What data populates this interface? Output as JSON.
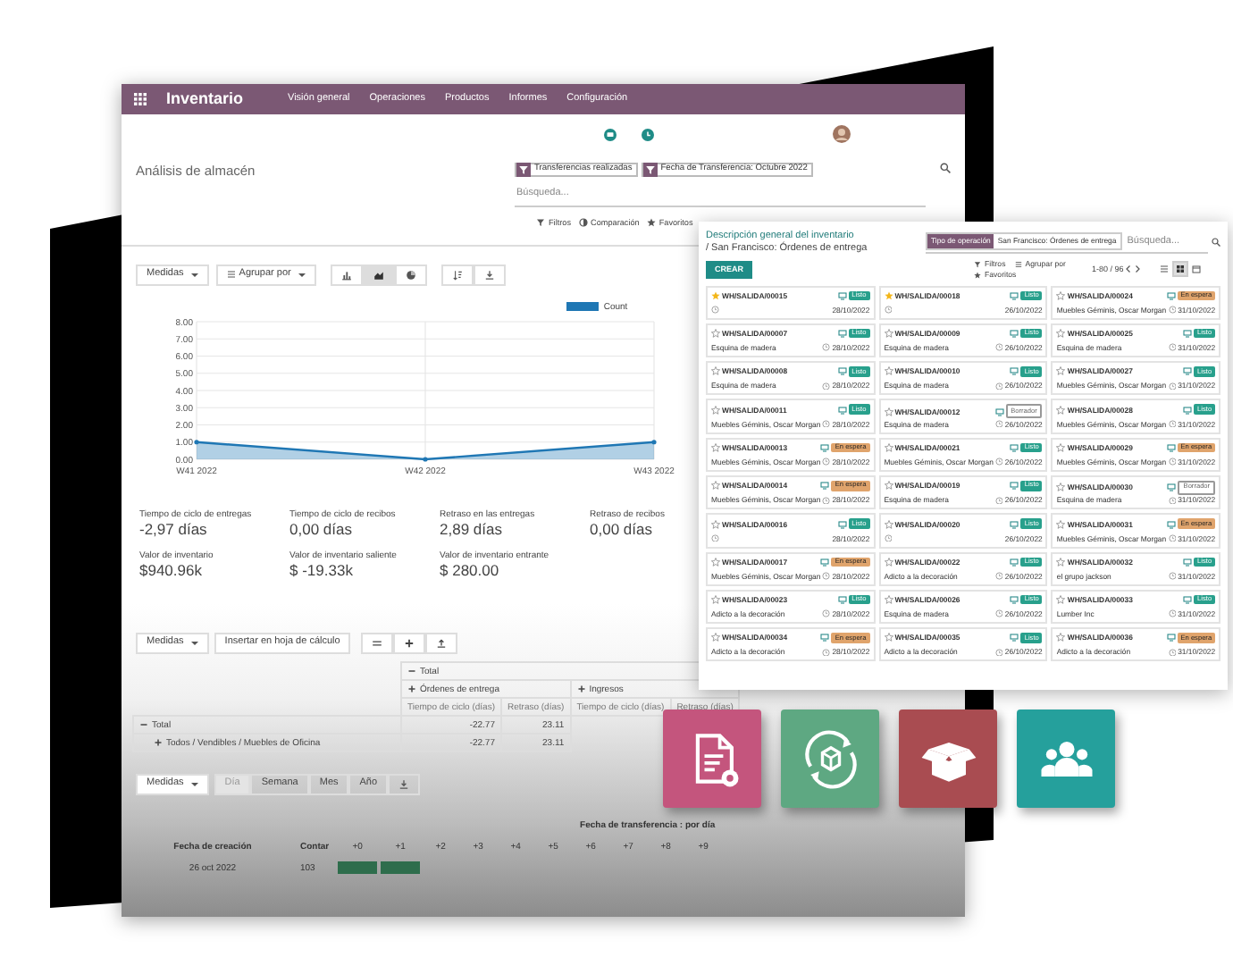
{
  "navbar": {
    "app_title": "Inventario",
    "menu": [
      {
        "label": "Visión general"
      },
      {
        "label": "Operaciones"
      },
      {
        "label": "Productos"
      },
      {
        "label": "Informes"
      },
      {
        "label": "Configuración"
      }
    ]
  },
  "control_panel": {
    "title": "Análisis de almacén",
    "facets": [
      {
        "label": "Transferencias realizadas"
      },
      {
        "label": "Fecha de Transferencia: Octubre 2022"
      }
    ],
    "search": {
      "placeholder": "Búsqueda..."
    },
    "menus": [
      {
        "kind": "filter",
        "label": "Filtros"
      },
      {
        "kind": "compare",
        "label": "Comparación"
      },
      {
        "kind": "favorite",
        "label": "Favoritos"
      }
    ]
  },
  "graph": {
    "toolbar": {
      "measures": "Medidas",
      "group_by": "Agrupar por",
      "chart_types": [
        {
          "kind": "bar",
          "selected": false
        },
        {
          "kind": "area",
          "selected": true
        },
        {
          "kind": "pie",
          "selected": false
        }
      ]
    },
    "chart_data": {
      "type": "area",
      "categories": [
        "W41 2022",
        "W42 2022",
        "W43 2022"
      ],
      "series": [
        {
          "name": "Count",
          "color": "#1f77b4",
          "values": [
            1,
            0,
            1
          ]
        }
      ],
      "ylim": [
        0,
        8
      ],
      "grid": true,
      "yticks": [
        {
          "value": 0,
          "label": "0.00"
        },
        {
          "value": 1,
          "label": "1.00"
        },
        {
          "value": 2,
          "label": "2.00"
        },
        {
          "value": 3,
          "label": "3.00"
        },
        {
          "value": 4,
          "label": "4.00"
        },
        {
          "value": 5,
          "label": "5.00"
        },
        {
          "value": 6,
          "label": "6.00"
        },
        {
          "value": 7,
          "label": "7.00"
        },
        {
          "value": 8,
          "label": "8.00"
        }
      ]
    }
  },
  "kpis": [
    {
      "label": "Tiempo de ciclo de entregas",
      "value": "-2,97 días"
    },
    {
      "label": "Tiempo de ciclo de recibos",
      "value": "0,00 días"
    },
    {
      "label": "Retraso en las entregas",
      "value": "2,89 días"
    },
    {
      "label": "Retraso de recibos",
      "value": "0,00 días"
    },
    {
      "label": "Valor de inventario",
      "value": "$940.96k"
    },
    {
      "label": "Valor de inventario saliente",
      "value": "$ -19.33k"
    },
    {
      "label": "Valor de inventario entrante",
      "value": "$ 280.00"
    }
  ],
  "pivot": {
    "toolbar": {
      "measures": "Medidas",
      "export": "Insertar en hoja de cálculo"
    },
    "header_total": {
      "label": "Total",
      "expanded": true
    },
    "groups": [
      {
        "label": "Órdenes de entrega",
        "expanded": false
      },
      {
        "label": "Ingresos",
        "expanded": false
      }
    ],
    "measures": [
      "Tiempo de ciclo (días)",
      "Retraso (días)",
      "Tiempo de ciclo (días)",
      "Retraso (días)"
    ],
    "rows": [
      {
        "label": "Total",
        "expanded": true,
        "values": [
          "-22.77",
          "23.11"
        ],
        "children": [
          {
            "label": "Todos / Vendibles / Muebles de Oficina",
            "expanded": false,
            "values": [
              "-22.77",
              "23.11"
            ]
          }
        ]
      }
    ]
  },
  "cohort": {
    "toolbar": {
      "measures": "Medidas",
      "intervals": [
        {
          "label": "Día",
          "selected": true
        },
        {
          "label": "Semana",
          "selected": false
        },
        {
          "label": "Mes",
          "selected": false
        },
        {
          "label": "Año",
          "selected": false
        }
      ]
    },
    "row_header": "Fecha de creación",
    "count_header": "Contar",
    "column_group": "Fecha de transferencia : por día",
    "columns": [
      "+0",
      "+1",
      "+2",
      "+3",
      "+4",
      "+5",
      "+6",
      "+7",
      "+8",
      "+9"
    ],
    "rows": [
      {
        "date": "26 oct 2022",
        "count": "103",
        "cells": [
          {
            "kind": "filled"
          },
          {
            "kind": "filled"
          }
        ]
      }
    ]
  },
  "kanban_window": {
    "breadcrumb": {
      "parent": "Descripción general del inventario",
      "current": "/ San Francisco: Órdenes de entrega"
    },
    "create_button": "CREAR",
    "facets": [
      {
        "field": "Tipo de operación",
        "value": "San Francisco: Órdenes de entrega"
      }
    ],
    "search": {
      "placeholder": "Búsqueda..."
    },
    "menus": [
      {
        "kind": "filter",
        "label": "Filtros"
      },
      {
        "kind": "group",
        "label": "Agrupar por"
      },
      {
        "kind": "favorite",
        "label": "Favoritos"
      }
    ],
    "pager": "1-80 / 96",
    "views": [
      {
        "kind": "list",
        "selected": false
      },
      {
        "kind": "kanban",
        "selected": true
      },
      {
        "kind": "calendar",
        "selected": false
      }
    ],
    "cards": [
      {
        "ref": "WH/SALIDA/00015",
        "starred": true,
        "date": "28/10/2022",
        "kind": "ready",
        "status": "Listo"
      },
      {
        "ref": "WH/SALIDA/00018",
        "starred": true,
        "date": "26/10/2022",
        "kind": "ready",
        "status": "Listo"
      },
      {
        "ref": "WH/SALIDA/00024",
        "starred": false,
        "contact": "Muebles Géminis, Oscar Morgan",
        "date": "31/10/2022",
        "kind": "waiting",
        "status": "En espera"
      },
      {
        "ref": "WH/SALIDA/00007",
        "starred": false,
        "contact": "Esquina de madera",
        "date": "28/10/2022",
        "kind": "ready",
        "status": "Listo"
      },
      {
        "ref": "WH/SALIDA/00009",
        "starred": false,
        "contact": "Esquina de madera",
        "date": "26/10/2022",
        "kind": "ready",
        "status": "Listo"
      },
      {
        "ref": "WH/SALIDA/00025",
        "starred": false,
        "contact": "Esquina de madera",
        "date": "31/10/2022",
        "kind": "ready",
        "status": "Listo"
      },
      {
        "ref": "WH/SALIDA/00008",
        "starred": false,
        "contact": "Esquina de madera",
        "date": "28/10/2022",
        "kind": "ready",
        "status": "Listo"
      },
      {
        "ref": "WH/SALIDA/00010",
        "starred": false,
        "contact": "Esquina de madera",
        "date": "26/10/2022",
        "kind": "ready",
        "status": "Listo"
      },
      {
        "ref": "WH/SALIDA/00027",
        "starred": false,
        "contact": "Muebles Géminis, Oscar Morgan",
        "date": "31/10/2022",
        "kind": "ready",
        "status": "Listo"
      },
      {
        "ref": "WH/SALIDA/00011",
        "starred": false,
        "contact": "Muebles Géminis, Oscar Morgan",
        "date": "28/10/2022",
        "kind": "ready",
        "status": "Listo"
      },
      {
        "ref": "WH/SALIDA/00012",
        "starred": false,
        "contact": "Esquina de madera",
        "date": "26/10/2022",
        "kind": "draft",
        "status": "Borrador"
      },
      {
        "ref": "WH/SALIDA/00028",
        "starred": false,
        "contact": "Muebles Géminis, Oscar Morgan",
        "date": "31/10/2022",
        "kind": "ready",
        "status": "Listo"
      },
      {
        "ref": "WH/SALIDA/00013",
        "starred": false,
        "contact": "Muebles Géminis, Oscar Morgan",
        "date": "28/10/2022",
        "kind": "waiting",
        "status": "En espera"
      },
      {
        "ref": "WH/SALIDA/00021",
        "starred": false,
        "contact": "Muebles Géminis, Oscar Morgan",
        "date": "26/10/2022",
        "kind": "ready",
        "status": "Listo"
      },
      {
        "ref": "WH/SALIDA/00029",
        "starred": false,
        "contact": "Muebles Géminis, Oscar Morgan",
        "date": "31/10/2022",
        "kind": "waiting",
        "status": "En espera"
      },
      {
        "ref": "WH/SALIDA/00014",
        "starred": false,
        "contact": "Muebles Géminis, Oscar Morgan",
        "date": "28/10/2022",
        "kind": "waiting",
        "status": "En espera"
      },
      {
        "ref": "WH/SALIDA/00019",
        "starred": false,
        "contact": "Esquina de madera",
        "date": "26/10/2022",
        "kind": "ready",
        "status": "Listo"
      },
      {
        "ref": "WH/SALIDA/00030",
        "starred": false,
        "contact": "Esquina de madera",
        "date": "31/10/2022",
        "kind": "draft",
        "status": "Borrador"
      },
      {
        "ref": "WH/SALIDA/00016",
        "starred": false,
        "date": "28/10/2022",
        "kind": "ready",
        "status": "Listo"
      },
      {
        "ref": "WH/SALIDA/00020",
        "starred": false,
        "date": "26/10/2022",
        "kind": "ready",
        "status": "Listo"
      },
      {
        "ref": "WH/SALIDA/00031",
        "starred": false,
        "contact": "Muebles Géminis, Oscar Morgan",
        "date": "31/10/2022",
        "kind": "waiting",
        "status": "En espera"
      },
      {
        "ref": "WH/SALIDA/00017",
        "starred": false,
        "contact": "Muebles Géminis, Oscar Morgan",
        "date": "28/10/2022",
        "kind": "waiting",
        "status": "En espera"
      },
      {
        "ref": "WH/SALIDA/00022",
        "starred": false,
        "contact": "Adicto a la decoración",
        "date": "26/10/2022",
        "kind": "ready",
        "status": "Listo"
      },
      {
        "ref": "WH/SALIDA/00032",
        "starred": false,
        "contact": "el grupo jackson",
        "date": "31/10/2022",
        "kind": "ready",
        "status": "Listo"
      },
      {
        "ref": "WH/SALIDA/00023",
        "starred": false,
        "contact": "Adicto a la decoración",
        "date": "28/10/2022",
        "kind": "ready",
        "status": "Listo"
      },
      {
        "ref": "WH/SALIDA/00026",
        "starred": false,
        "contact": "Esquina de madera",
        "date": "26/10/2022",
        "kind": "ready",
        "status": "Listo"
      },
      {
        "ref": "WH/SALIDA/00033",
        "starred": false,
        "contact": "Lumber Inc",
        "date": "31/10/2022",
        "kind": "ready",
        "status": "Listo"
      },
      {
        "ref": "WH/SALIDA/00034",
        "starred": false,
        "contact": "Adicto a la decoración",
        "date": "28/10/2022",
        "kind": "waiting",
        "status": "En espera"
      },
      {
        "ref": "WH/SALIDA/00035",
        "starred": false,
        "contact": "Adicto a la decoración",
        "date": "26/10/2022",
        "kind": "ready",
        "status": "Listo"
      },
      {
        "ref": "WH/SALIDA/00036",
        "starred": false,
        "contact": "Adicto a la decoración",
        "date": "31/10/2022",
        "kind": "waiting",
        "status": "En espera"
      }
    ]
  },
  "app_tiles": [
    {
      "kind": "document-gear",
      "color": "#c4557d"
    },
    {
      "kind": "box-cycle",
      "color": "#5ea882"
    },
    {
      "kind": "open-box",
      "color": "#a94c51"
    },
    {
      "kind": "people",
      "color": "#25a09c"
    }
  ]
}
